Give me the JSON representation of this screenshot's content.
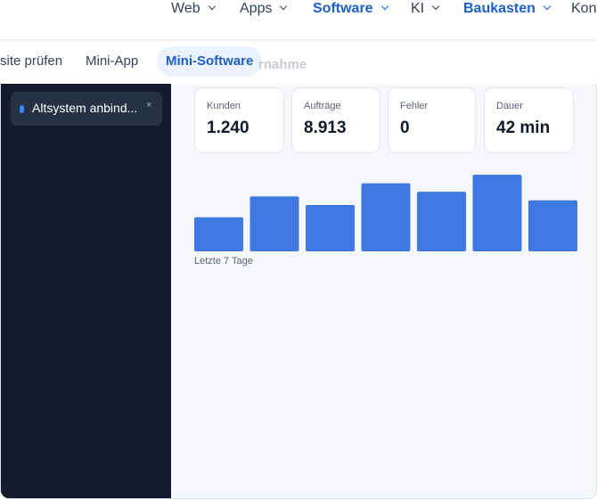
{
  "nav": {
    "items": [
      {
        "label": "Web",
        "active": false
      },
      {
        "label": "Apps",
        "active": false
      },
      {
        "label": "Software",
        "active": true
      },
      {
        "label": "KI",
        "active": false
      },
      {
        "label": "Baukasten",
        "active": true
      },
      {
        "label": "Kont",
        "active": false
      }
    ]
  },
  "tabs": [
    {
      "label": "site prüfen",
      "active": false
    },
    {
      "label": "Mini-App",
      "active": false
    },
    {
      "label": "Mini-Software",
      "active": true
    }
  ],
  "ghost_heading": "rnahme",
  "sidebar": {
    "item": {
      "label": "Altsystem anbind...",
      "close": "×"
    }
  },
  "stats": [
    {
      "label": "Kunden",
      "value": "1.240"
    },
    {
      "label": "Aufträge",
      "value": "8.913"
    },
    {
      "label": "Fehler",
      "value": "0"
    },
    {
      "label": "Dauer",
      "value": "42 min"
    }
  ],
  "chart_data": {
    "type": "bar",
    "values": [
      36,
      58,
      49,
      72,
      63,
      81,
      54
    ],
    "ylim": [
      0,
      81
    ],
    "caption": "Letzte 7 Tage",
    "color": "#3f78e0"
  }
}
